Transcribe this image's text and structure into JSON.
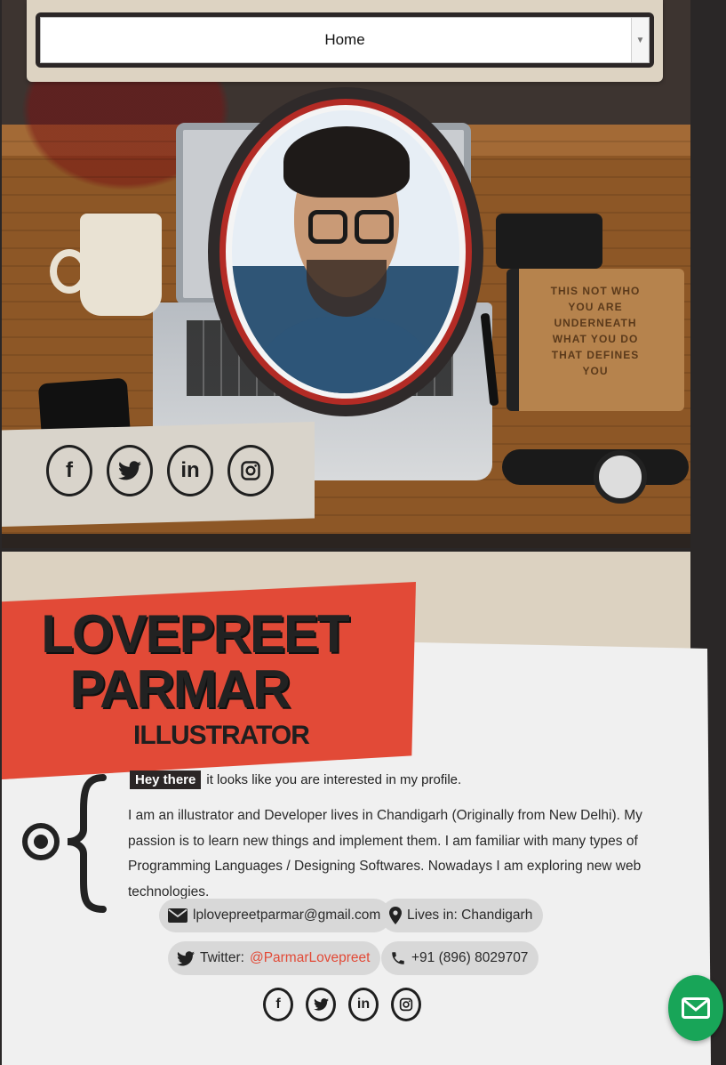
{
  "nav": {
    "selected": "Home"
  },
  "hero": {
    "notebook_text": "THIS NOT WHO YOU ARE UNDERNEATH WHAT YOU DO THAT DEFINES YOU",
    "social_icons": [
      "facebook-icon",
      "twitter-icon",
      "linkedin-icon",
      "instagram-icon"
    ]
  },
  "profile": {
    "name_line_1": "LOVEPREET",
    "name_line_2": "PARMAR",
    "role": "ILLUSTRATOR",
    "greeting_tag": "Hey there",
    "greeting_text": "it looks like you are interested in my profile.",
    "bio": "I am an illustrator and Developer lives in Chandigarh (Originally from New Delhi). My passion is to learn new things and implement them. I am familiar with many types of Programming Languages / Designing Softwares. Nowadays I am exploring new web technologies."
  },
  "contact": {
    "email": "lplovepreetparmar@gmail.com",
    "location": "Lives in: Chandigarh",
    "twitter_label": "Twitter:",
    "twitter_handle": "@ParmarLovepreet",
    "phone": "+91 (896) 8029707"
  },
  "colors": {
    "accent_red": "#e24a37",
    "dark": "#2b2626",
    "card_bg": "#f0f0f0",
    "beige": "#dcd2c1",
    "fab_green": "#18a558"
  }
}
